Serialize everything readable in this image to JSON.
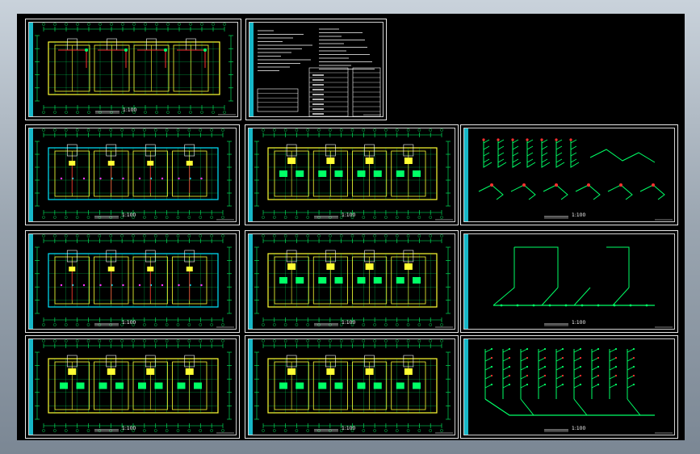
{
  "viewer": {
    "background": "#000000",
    "colors": {
      "wall": "#ffff33",
      "grid": "#00ff66",
      "pipe_red": "#ff3030",
      "pipe_cyan": "#00e5ff",
      "magenta": "#ff33ff",
      "sheet_border": "#e8e8e8",
      "side_bar": "#17b7c8"
    }
  },
  "sheets": [
    {
      "id": "sheet-1",
      "type": "floor-plan",
      "caption": "",
      "scale": "1:100"
    },
    {
      "id": "sheet-2",
      "type": "notes-legend",
      "caption": "",
      "scale": ""
    },
    {
      "id": "sheet-3",
      "type": "floor-plan",
      "caption": "",
      "scale": "1:100"
    },
    {
      "id": "sheet-4",
      "type": "floor-plan",
      "caption": "",
      "scale": "1:100"
    },
    {
      "id": "sheet-5",
      "type": "isometric",
      "caption": "",
      "scale": "1:100"
    },
    {
      "id": "sheet-6",
      "type": "floor-plan",
      "caption": "",
      "scale": "1:100"
    },
    {
      "id": "sheet-7",
      "type": "floor-plan",
      "caption": "",
      "scale": "1:100"
    },
    {
      "id": "sheet-8",
      "type": "isometric",
      "caption": "",
      "scale": "1:100"
    },
    {
      "id": "sheet-9",
      "type": "floor-plan",
      "caption": "",
      "scale": "1:100"
    },
    {
      "id": "sheet-10",
      "type": "floor-plan",
      "caption": "",
      "scale": "1:100"
    },
    {
      "id": "sheet-11",
      "type": "isometric",
      "caption": "",
      "scale": "1:100"
    }
  ]
}
